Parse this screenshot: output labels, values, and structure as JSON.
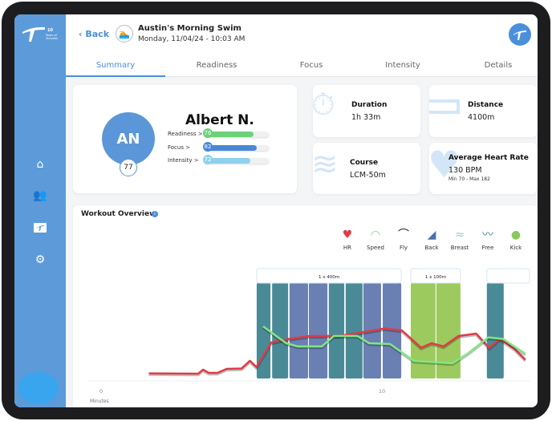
{
  "sidebar": {
    "logo_text": "10 Years of Victories",
    "items": [
      {
        "name": "home",
        "icon": "home-icon"
      },
      {
        "name": "team",
        "icon": "people-icon"
      },
      {
        "name": "workouts",
        "icon": "logo-icon"
      },
      {
        "name": "settings",
        "icon": "gear-icon"
      }
    ]
  },
  "header": {
    "back_label": "‹ Back",
    "title": "Austin's Morning Swim",
    "date": "Monday, 11/04/24 - 10:03 AM"
  },
  "tabs": [
    {
      "label": "Summary",
      "active": true
    },
    {
      "label": "Readiness"
    },
    {
      "label": "Focus"
    },
    {
      "label": "Intensity"
    },
    {
      "label": "Details"
    }
  ],
  "athlete": {
    "initials": "AN",
    "score": "77",
    "name": "Albert N.",
    "metrics": [
      {
        "label": "Readiness >",
        "value": 76,
        "color": "#6dd17a"
      },
      {
        "label": "Focus >",
        "value": 82,
        "color": "#4a87d6"
      },
      {
        "label": "Intensity >",
        "value": 72,
        "color": "#8fd0ec"
      }
    ]
  },
  "stats": {
    "duration": {
      "title": "Duration",
      "value": "1h 33m"
    },
    "distance": {
      "title": "Distance",
      "value": "4100m"
    },
    "course": {
      "title": "Course",
      "value": "LCM-50m"
    },
    "heart_rate": {
      "title": "Average Heart Rate",
      "value": "130 BPM",
      "sub": "Min 70 - Max 182"
    }
  },
  "workout": {
    "title": "Workout Overview",
    "legend": [
      {
        "label": "HR",
        "icon": "heart-icon",
        "color": "#e03b45"
      },
      {
        "label": "Speed",
        "icon": "speedometer-icon",
        "color": "#6ee07a"
      },
      {
        "label": "Fly",
        "icon": "fly-icon",
        "color": "#111"
      },
      {
        "label": "Back",
        "icon": "backstroke-icon",
        "color": "#4a6fb5"
      },
      {
        "label": "Breast",
        "icon": "breaststroke-icon",
        "color": "#8fc8d8"
      },
      {
        "label": "Free",
        "icon": "freestyle-icon",
        "color": "#3a8a9a"
      },
      {
        "label": "Kick",
        "icon": "kick-icon",
        "color": "#8ac85a"
      }
    ]
  },
  "chart_data": {
    "type": "line",
    "xlabel": "Minutes",
    "xticks": [
      0,
      10
    ],
    "xlim": [
      -0.46,
      15.26
    ],
    "ylim": [
      0,
      100
    ],
    "sets": [
      {
        "label": "1 x 400m",
        "start": 5.54,
        "end": 10.69
      },
      {
        "label": "1 x 100m",
        "start": 11.03,
        "end": 12.8
      },
      {
        "label": "",
        "start": 13.74,
        "end": 15.26
      }
    ],
    "intervals": [
      {
        "start": 5.54,
        "end": 6.03,
        "color": "#4a8a96"
      },
      {
        "start": 6.09,
        "end": 6.66,
        "color": "#4a8a96"
      },
      {
        "start": 6.71,
        "end": 7.37,
        "color": "#6a80b2"
      },
      {
        "start": 7.4,
        "end": 8.06,
        "color": "#6a80b2"
      },
      {
        "start": 8.11,
        "end": 8.66,
        "color": "#4a8a96"
      },
      {
        "start": 8.71,
        "end": 9.31,
        "color": "#4a8a96"
      },
      {
        "start": 9.34,
        "end": 9.97,
        "color": "#6a80b2"
      },
      {
        "start": 10.03,
        "end": 10.69,
        "color": "#6a80b2"
      },
      {
        "start": 11.03,
        "end": 11.91,
        "color": "#9cca5e"
      },
      {
        "start": 11.94,
        "end": 12.8,
        "color": "#9cca5e"
      },
      {
        "start": 13.74,
        "end": 14.34,
        "color": "#4a8a96"
      }
    ],
    "series": [
      {
        "name": "HR",
        "color": "#e03b45",
        "x": [
          1.7,
          3.46,
          3.63,
          3.83,
          4.14,
          4.47,
          5.0,
          5.3,
          5.53,
          6.06,
          6.69,
          7.43,
          8.49,
          9.54,
          10.09,
          10.71,
          11.4,
          11.77,
          12.2,
          12.73,
          13.36,
          13.83,
          14.2,
          14.74,
          15.11
        ],
        "y": [
          6,
          5.8,
          9.4,
          6.5,
          6.5,
          10.1,
          10.4,
          17.3,
          11.7,
          33.8,
          37,
          39.6,
          39.6,
          43.9,
          46.3,
          44.6,
          29,
          33.1,
          30.2,
          39.6,
          41.7,
          28.8,
          37,
          27.7,
          18.3
        ]
      },
      {
        "name": "Speed",
        "color": "#7fe884",
        "x": [
          5.77,
          6.59,
          7.01,
          7.86,
          8.29,
          9.13,
          9.54,
          10.29,
          11.14,
          12.51,
          13.05,
          13.79,
          14.31,
          15.11
        ],
        "y": [
          48.2,
          33.1,
          30.2,
          30.2,
          39.6,
          39.6,
          33.1,
          32.4,
          17.3,
          15.1,
          23.7,
          38.3,
          37,
          23.7
        ]
      }
    ]
  }
}
